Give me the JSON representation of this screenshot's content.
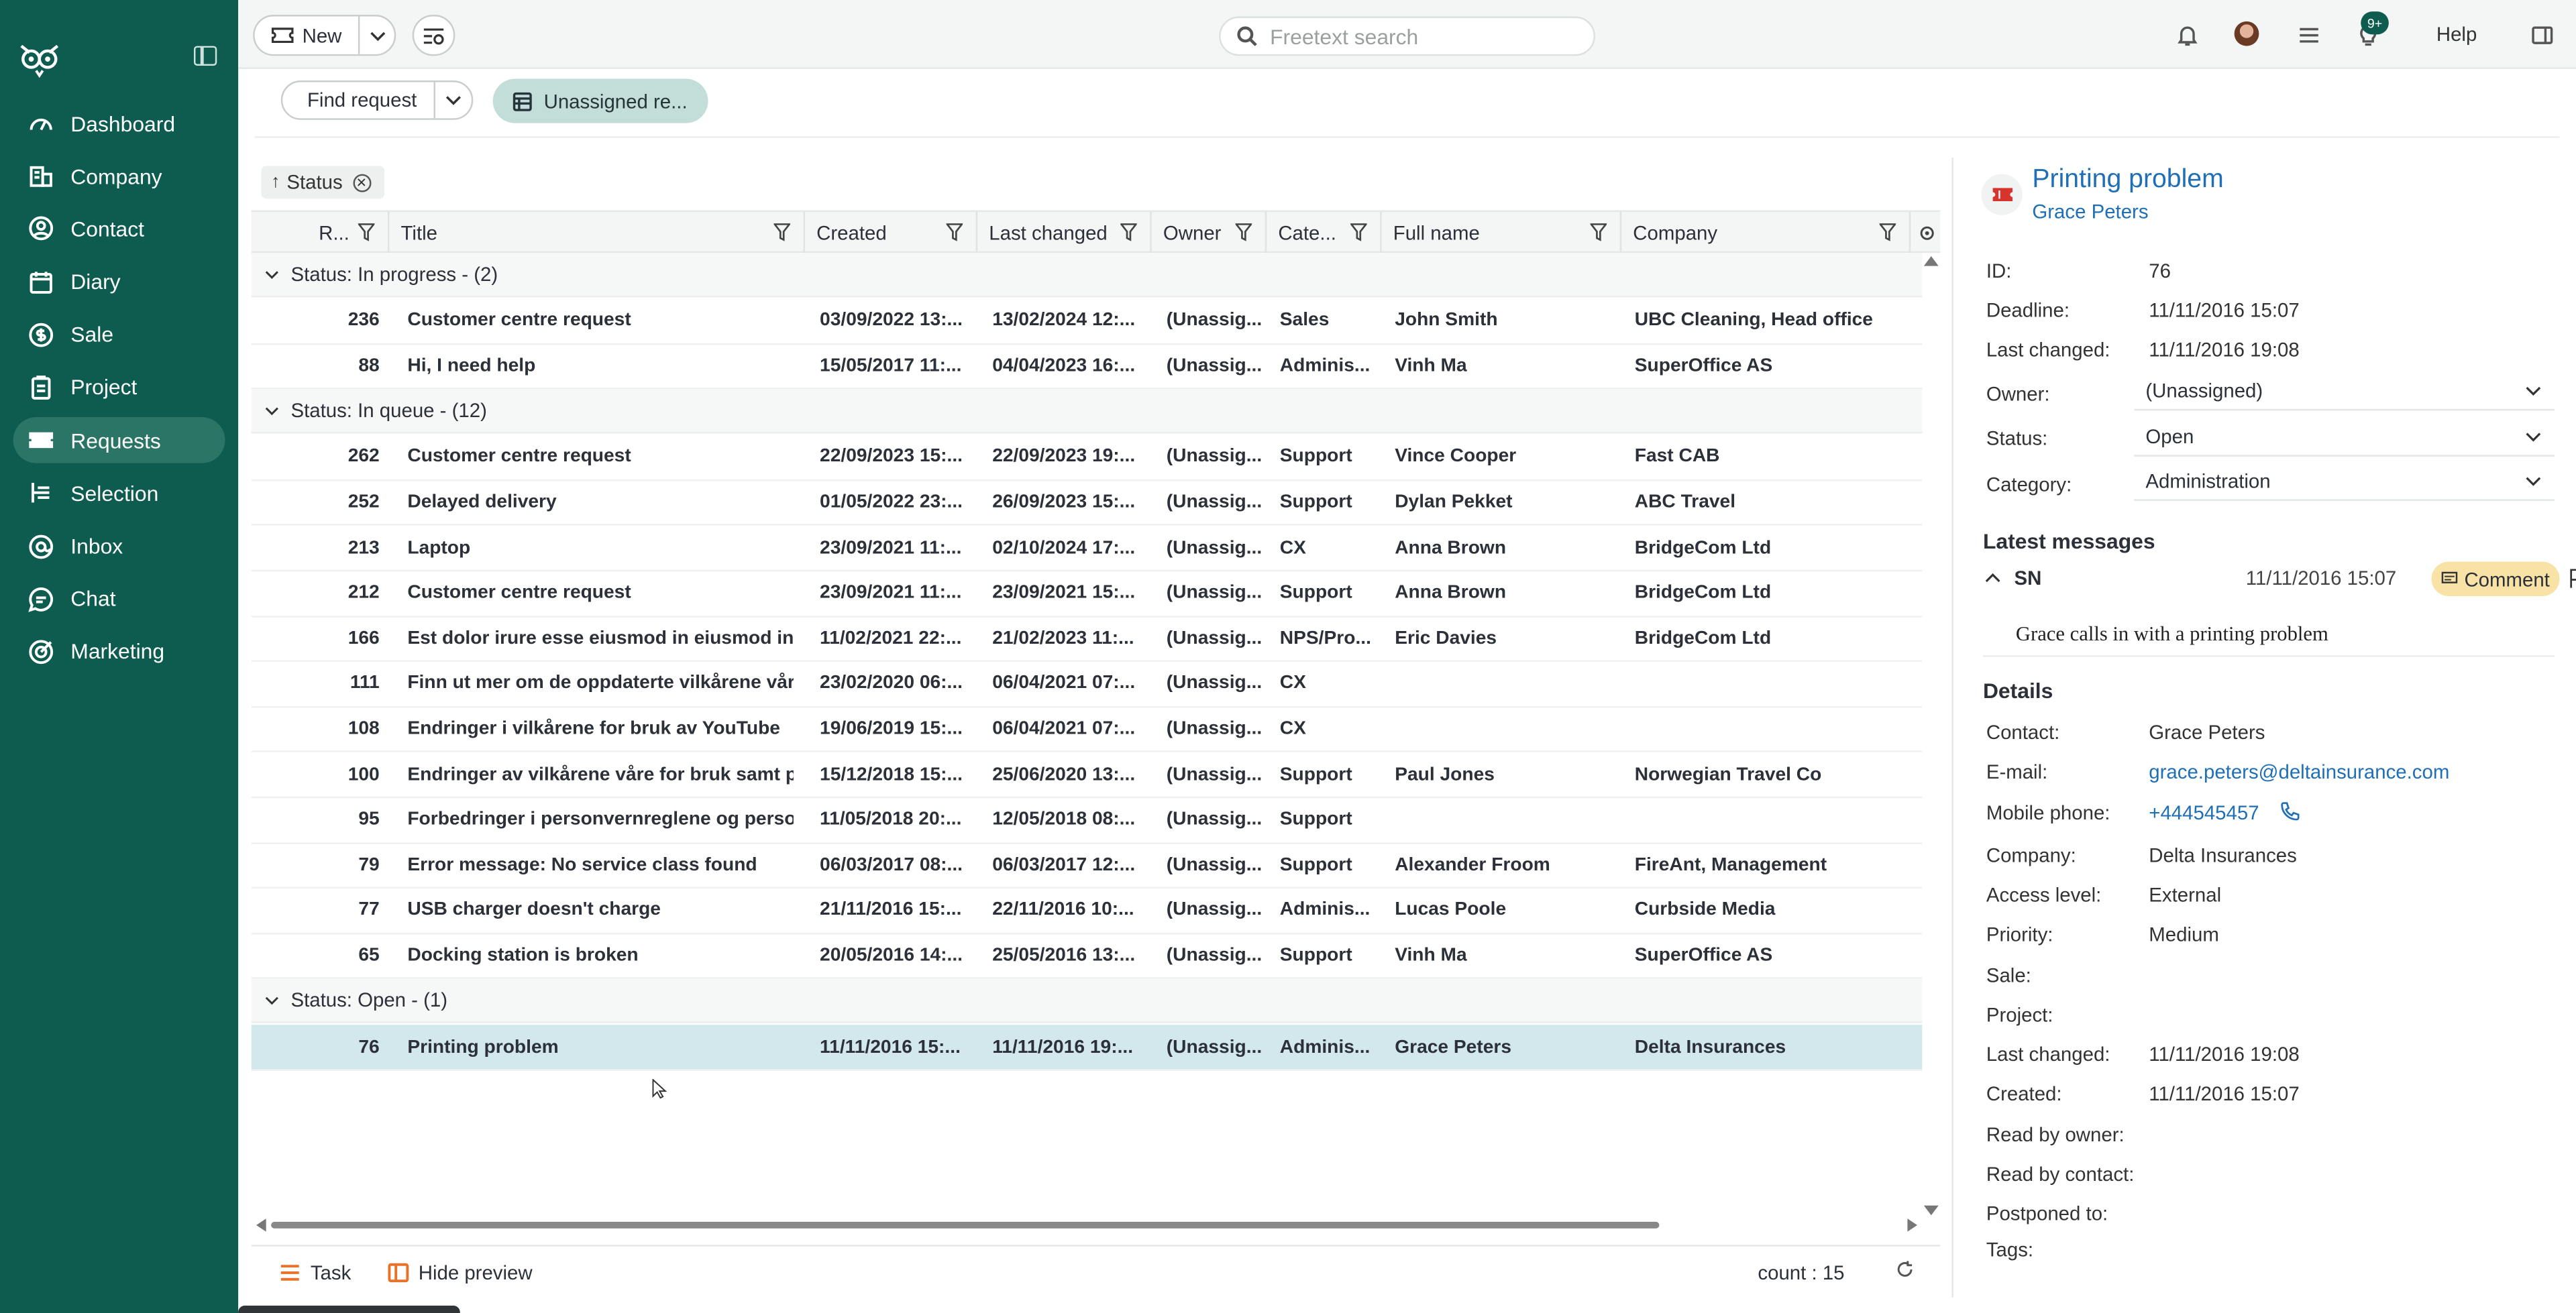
{
  "sidebar": {
    "items": [
      {
        "label": "Dashboard",
        "icon": "dashboard-icon"
      },
      {
        "label": "Company",
        "icon": "company-icon"
      },
      {
        "label": "Contact",
        "icon": "contact-icon"
      },
      {
        "label": "Diary",
        "icon": "diary-icon"
      },
      {
        "label": "Sale",
        "icon": "sale-icon"
      },
      {
        "label": "Project",
        "icon": "project-icon"
      },
      {
        "label": "Requests",
        "icon": "requests-icon",
        "active": true
      },
      {
        "label": "Selection",
        "icon": "selection-icon"
      },
      {
        "label": "Inbox",
        "icon": "inbox-icon"
      },
      {
        "label": "Chat",
        "icon": "chat-icon"
      },
      {
        "label": "Marketing",
        "icon": "marketing-icon"
      }
    ]
  },
  "topbar": {
    "new_label": "New",
    "search_placeholder": "Freetext search",
    "badge": "9+",
    "help": "Help"
  },
  "subbar": {
    "find_label": "Find request",
    "tab_label": "Unassigned re..."
  },
  "grid": {
    "group_chip": "Status",
    "columns": [
      "R...",
      "Title",
      "Created",
      "Last changed",
      "Owner",
      "Cate...",
      "Full name",
      "Company"
    ],
    "groups": [
      {
        "label": "Status: In progress - (2)",
        "rows": [
          {
            "id": "236",
            "title": "Customer centre request",
            "created": "03/09/2022 13:...",
            "changed": "13/02/2024 12:...",
            "owner": "(Unassig...",
            "cat": "Sales",
            "name": "John Smith",
            "company": "UBC Cleaning, Head office"
          },
          {
            "id": "88",
            "title": "Hi, I need help",
            "created": "15/05/2017 11:...",
            "changed": "04/04/2023 16:...",
            "owner": "(Unassig...",
            "cat": "Adminis...",
            "name": "Vinh Ma",
            "company": "SuperOffice AS"
          }
        ]
      },
      {
        "label": "Status: In queue - (12)",
        "rows": [
          {
            "id": "262",
            "title": "Customer centre request",
            "created": "22/09/2023 15:...",
            "changed": "22/09/2023 19:...",
            "owner": "(Unassig...",
            "cat": "Support",
            "name": "Vince Cooper",
            "company": "Fast CAB"
          },
          {
            "id": "252",
            "title": "Delayed delivery",
            "created": "01/05/2022 23:...",
            "changed": "26/09/2023 15:...",
            "owner": "(Unassig...",
            "cat": "Support",
            "name": "Dylan Pekket",
            "company": "ABC Travel"
          },
          {
            "id": "213",
            "title": "Laptop",
            "created": "23/09/2021 11:...",
            "changed": "02/10/2024 17:...",
            "owner": "(Unassig...",
            "cat": "CX",
            "name": "Anna Brown",
            "company": "BridgeCom Ltd"
          },
          {
            "id": "212",
            "title": "Customer centre request",
            "created": "23/09/2021 11:...",
            "changed": "23/09/2021 15:...",
            "owner": "(Unassig...",
            "cat": "Support",
            "name": "Anna Brown",
            "company": "BridgeCom Ltd"
          },
          {
            "id": "166",
            "title": "Est dolor irure esse eiusmod in eiusmod in nisi...",
            "created": "11/02/2021 22:...",
            "changed": "21/02/2023 11:...",
            "owner": "(Unassig...",
            "cat": "NPS/Pro...",
            "name": "Eric Davies",
            "company": "BridgeCom Ltd"
          },
          {
            "id": "111",
            "title": "Finn ut mer om de oppdaterte vilkårene våre f...",
            "created": "23/02/2020 06:...",
            "changed": "06/04/2021 07:...",
            "owner": "(Unassig...",
            "cat": "CX",
            "name": "",
            "company": ""
          },
          {
            "id": "108",
            "title": "Endringer i vilkårene for bruk av YouTube",
            "created": "19/06/2019 15:...",
            "changed": "06/04/2021 07:...",
            "owner": "(Unassig...",
            "cat": "CX",
            "name": "",
            "company": ""
          },
          {
            "id": "100",
            "title": "Endringer av vilkårene våre for bruk samt per...",
            "created": "15/12/2018 15:...",
            "changed": "25/06/2020 13:...",
            "owner": "(Unassig...",
            "cat": "Support",
            "name": "Paul Jones",
            "company": "Norwegian Travel Co"
          },
          {
            "id": "95",
            "title": "Forbedringer i personvernreglene og personv...",
            "created": "11/05/2018 20:...",
            "changed": "12/05/2018 08:...",
            "owner": "(Unassig...",
            "cat": "Support",
            "name": "",
            "company": ""
          },
          {
            "id": "79",
            "title": "Error message: No service class found",
            "created": "06/03/2017 08:...",
            "changed": "06/03/2017 12:...",
            "owner": "(Unassig...",
            "cat": "Support",
            "name": "Alexander Froom",
            "company": "FireAnt, Management"
          },
          {
            "id": "77",
            "title": "USB charger doesn't charge",
            "created": "21/11/2016 15:...",
            "changed": "22/11/2016 10:...",
            "owner": "(Unassig...",
            "cat": "Adminis...",
            "name": "Lucas Poole",
            "company": "Curbside Media"
          },
          {
            "id": "65",
            "title": "Docking station is broken",
            "created": "20/05/2016 14:...",
            "changed": "25/05/2016 13:...",
            "owner": "(Unassig...",
            "cat": "Support",
            "name": "Vinh Ma",
            "company": "SuperOffice AS"
          }
        ]
      },
      {
        "label": "Status: Open - (1)",
        "rows": [
          {
            "id": "76",
            "title": "Printing problem",
            "created": "11/11/2016 15:...",
            "changed": "11/11/2016 19:...",
            "owner": "(Unassig...",
            "cat": "Adminis...",
            "name": "Grace Peters",
            "company": "Delta Insurances",
            "selected": true
          }
        ]
      }
    ],
    "footer": {
      "task": "Task",
      "hide_preview": "Hide preview",
      "count": "count : 15"
    }
  },
  "preview": {
    "title": "Printing problem",
    "contact": "Grace Peters",
    "id_label": "ID:",
    "id": "76",
    "deadline_label": "Deadline:",
    "deadline": "11/11/2016 15:07",
    "changed_label": "Last changed:",
    "changed": "11/11/2016 19:08",
    "owner_label": "Owner:",
    "owner": "(Unassigned)",
    "status_label": "Status:",
    "status": "Open",
    "category_label": "Category:",
    "category": "Administration",
    "latest_messages": "Latest messages",
    "msg_author": "SN",
    "msg_time": "11/11/2016 15:07",
    "msg_type": "Comment",
    "msg_text": "Grace calls in with a printing problem",
    "details": "Details",
    "d": {
      "contact_label": "Contact:",
      "contact": "Grace Peters",
      "email_label": "E-mail:",
      "email": "grace.peters@deltainsurance.com",
      "mobile_label": "Mobile phone:",
      "mobile": "+444545457",
      "company_label": "Company:",
      "company": "Delta Insurances",
      "access_label": "Access level:",
      "access": "External",
      "priority_label": "Priority:",
      "priority": "Medium",
      "sale_label": "Sale:",
      "project_label": "Project:",
      "changed_label": "Last changed:",
      "changed": "11/11/2016 19:08",
      "created_label": "Created:",
      "created": "11/11/2016 15:07",
      "readowner_label": "Read by owner:",
      "readcontact_label": "Read by contact:",
      "postponed_label": "Postponed to:",
      "tags_label": "Tags:"
    }
  }
}
